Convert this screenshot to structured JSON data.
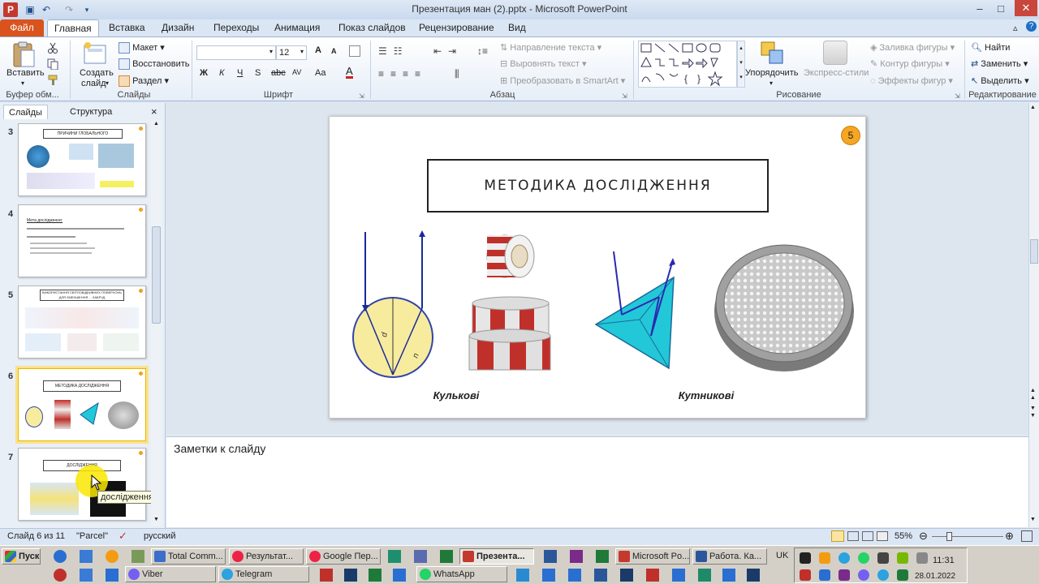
{
  "window": {
    "title": "Презентация ман (2).pptx - Microsoft PowerPoint"
  },
  "tabs": [
    "Файл",
    "Главная",
    "Вставка",
    "Дизайн",
    "Переходы",
    "Анимация",
    "Показ слайдов",
    "Рецензирование",
    "Вид"
  ],
  "ribbon": {
    "clipboard": {
      "label": "Буфер обм...",
      "paste": "Вставить"
    },
    "slides": {
      "label": "Слайды",
      "new_slide_1": "Создать",
      "new_slide_2": "слайд",
      "layout": "Макет",
      "reset": "Восстановить",
      "section": "Раздел"
    },
    "font": {
      "label": "Шрифт",
      "size": "12",
      "bold": "Ж",
      "italic": "К",
      "underline": "Ч",
      "strike": "S",
      "shadow": "abc",
      "spacing": "AV",
      "case": "Aa",
      "color": "A",
      "grow": "A",
      "shrink": "A"
    },
    "paragraph": {
      "label": "Абзац",
      "text_dir": "Направление текста",
      "align_text": "Выровнять текст",
      "smartart": "Преобразовать в SmartArt"
    },
    "drawing": {
      "label": "Рисование",
      "arrange": "Упорядочить",
      "quick_styles": "Экспресс-стили",
      "fill": "Заливка фигуры",
      "outline": "Контур фигуры",
      "effects": "Эффекты фигур"
    },
    "editing": {
      "label": "Редактирование",
      "find": "Найти",
      "replace": "Заменить",
      "select": "Выделить"
    }
  },
  "panel": {
    "tab_slides": "Слайды",
    "tab_outline": "Структура",
    "close": "×"
  },
  "thumbnails": [
    {
      "num": "3",
      "title": "ПРИЧИНИ ГЛОБАЛЬНОГО ПОТЕПЛІННЯ"
    },
    {
      "num": "4",
      "title": "Мета дослідження:"
    },
    {
      "num": "5",
      "title": "ВИКОРИСТАННЯ СВІТЛОВІДБИВНИХ ПОВЕРХОНЬ ДЛЯ ЗМЕНШЕННЯ ... ЗАБРУД"
    },
    {
      "num": "6",
      "title": "МЕТОДИКА ДОСЛІДЖЕННЯ"
    },
    {
      "num": "7",
      "title": "ДОСЛІДЖЕННЯ"
    }
  ],
  "tooltip": "дослідження",
  "slide": {
    "number": "5",
    "title": "МЕТОДИКА ДОСЛІДЖЕННЯ",
    "caption_left": "Кулькові",
    "caption_right": "Кутникові",
    "sphere_label_d": "d",
    "sphere_label_n": "n"
  },
  "notes": {
    "placeholder": "Заметки к слайду"
  },
  "status": {
    "slide": "Слайд 6 из 11",
    "theme": "\"Parcel\"",
    "lang": "русский",
    "zoom": "55%"
  },
  "taskbar": {
    "start": "Пуск",
    "row1": [
      "Total Comm...",
      "Результат...",
      "Google Пер...",
      "Презента...",
      "Microsoft Po...",
      "Работа. Ка..."
    ],
    "row2": [
      "Viber",
      "Telegram",
      "WhatsApp"
    ],
    "lang": "UK",
    "time": "11:31",
    "date": "28.01.2022"
  },
  "colors": {
    "accent": "#d9531e",
    "slide_badge": "#f5a623",
    "ribbon_blue": "#1e4e8c",
    "cyan": "#22c8d8",
    "sphere": "#f7ec9e"
  }
}
